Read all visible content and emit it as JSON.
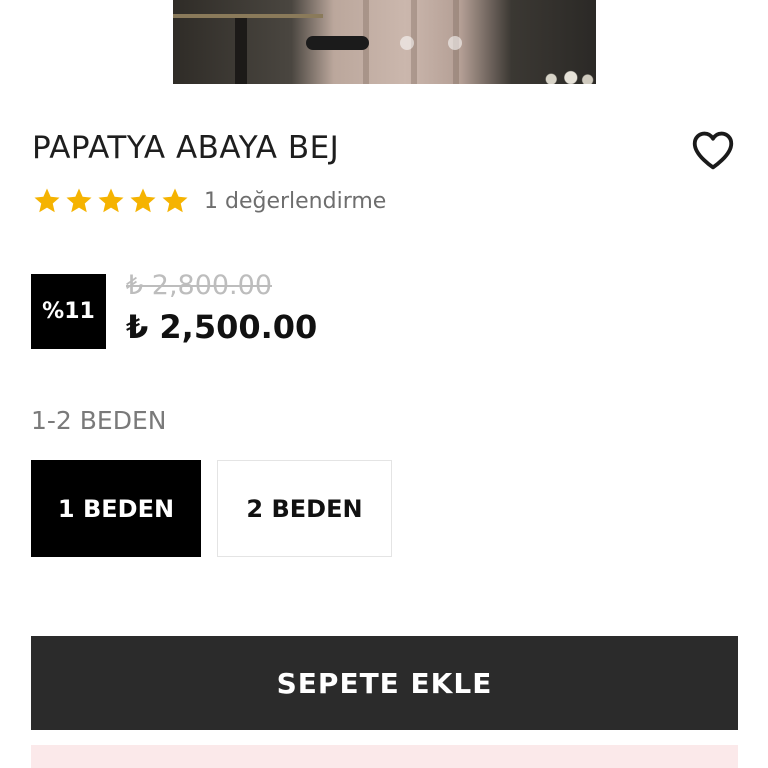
{
  "product": {
    "title": "PAPATYA ABAYA BEJ",
    "rating_stars": 5,
    "rating_max": 5,
    "reviews_text": "1 değerlendirme",
    "discount_badge": "%11",
    "old_price": "₺ 2,800.00",
    "price": "₺ 2,500.00"
  },
  "gallery": {
    "slide_count": 3,
    "active_slide": 1
  },
  "size_selector": {
    "label": "1-2 BEDEN",
    "options": [
      "1 BEDEN",
      "2 BEDEN"
    ],
    "selected": "1 BEDEN"
  },
  "actions": {
    "add_to_cart": "SEPETE EKLE",
    "favorite_icon": "heart-outline-icon"
  },
  "colors": {
    "star": "#F5B301",
    "primary_button": "#2B2B2B",
    "selected_option": "#000000",
    "promo_strip": "#FBE9EA"
  }
}
